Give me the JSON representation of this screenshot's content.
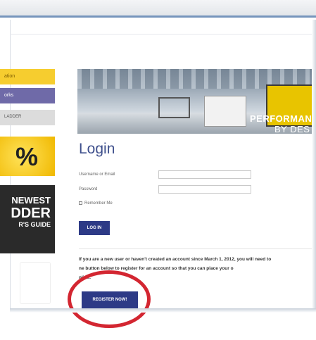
{
  "sidebar": {
    "tab1": "ation",
    "tab2": "orks",
    "tab3": "LADDER",
    "badge_text": "%",
    "guide_line1": "NEWEST",
    "guide_line2": "DDER",
    "guide_line3": "R'S GUIDE"
  },
  "hero": {
    "caption1": "PERFORMAN",
    "caption2": "BY DES"
  },
  "login": {
    "title": "Login",
    "username_label": "Username or Email",
    "password_label": "Password",
    "remember_label": "Remember Me",
    "login_button": "LOG IN"
  },
  "register": {
    "notice_line1": "If you are a new user or haven't created an account since March 1, 2012, you will need to",
    "notice_line2": "ne               button below to register for an account so that you can place your o",
    "notice_line3": "nline.",
    "button": "REGISTER NOW!"
  },
  "colors": {
    "brand_blue": "#2d3a86",
    "title_blue": "#3e4f8c",
    "highlight_red": "#d32631",
    "tab_yellow": "#f6cd2f",
    "tab_purple": "#6f6aa8"
  }
}
